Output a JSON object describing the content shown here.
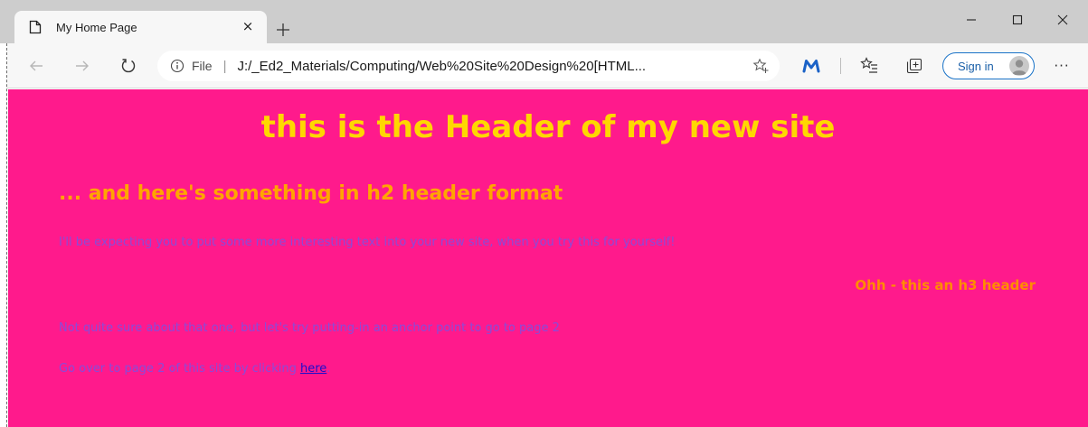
{
  "browser": {
    "tab": {
      "title": "My Home Page",
      "close_glyph": "×"
    },
    "new_tab_icon": "plus-icon",
    "window_controls": [
      "minimize-icon",
      "maximize-icon",
      "close-icon"
    ],
    "address_bar": {
      "scheme_label": "File",
      "separator": "|",
      "url": "J:/_Ed2_Materials/Computing/Web%20Site%20Design%20[HTML..."
    },
    "sign_in_label": "Sign in",
    "more_glyph": "···",
    "colors": {
      "accent": "#1a73c8",
      "chrome": "#cdcdcd",
      "toolbar": "#f7f7f7"
    }
  },
  "page": {
    "background": "#ff1a8c",
    "h1": "this is the Header of my new site",
    "h2": "... and here's something in h2 header format",
    "p1": "I'll be expecting you to put some more interesting text into your new site, when you try this for yourself!",
    "h3": "Ohh - this an h3 header",
    "p2": "Not quite sure about that one, but let's try putting-in an anchor point to go to page 2",
    "p3_prefix": "Go over to page 2 of this site by clicking ",
    "p3_link": "here",
    "p3_suffix": ".",
    "colors": {
      "h1": "#ffd700",
      "h2": "#ffa500",
      "h3": "#ff8c00",
      "text": "#8a4bd8",
      "link": "#1a0dcc"
    }
  }
}
